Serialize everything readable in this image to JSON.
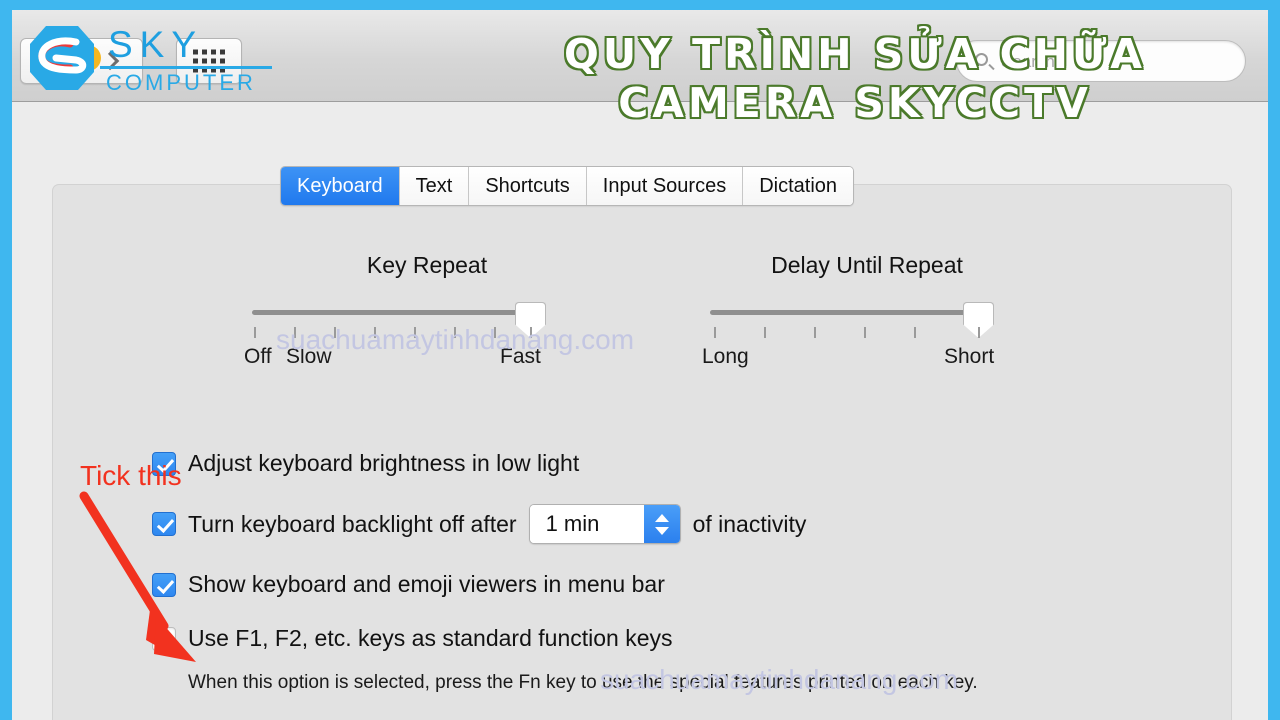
{
  "theme": {
    "frame_color": "#3fb7ef",
    "accent_blue": "#2f87f0",
    "annotation_red": "#f2321f",
    "title_outline_green": "#4b7a2b",
    "logo_blue": "#29a9e6",
    "watermark_color": "#c3c6e2"
  },
  "branding": {
    "logo_primary": "SKY",
    "logo_secondary": "COMPUTER"
  },
  "overlay_title": {
    "line1": "QUY TRÌNH SỬA CHỮA",
    "line2": "CAMERA SKYCCTV"
  },
  "toolbar": {
    "back_label": "Back",
    "forward_label": "Forward",
    "show_all_label": "Show All",
    "search_placeholder": "Search",
    "search_value": ""
  },
  "tabs": [
    {
      "label": "Keyboard",
      "active": true
    },
    {
      "label": "Text",
      "active": false
    },
    {
      "label": "Shortcuts",
      "active": false
    },
    {
      "label": "Input Sources",
      "active": false
    },
    {
      "label": "Dictation",
      "active": false
    }
  ],
  "sliders": {
    "key_repeat": {
      "title": "Key Repeat",
      "label_left": "Off",
      "label_left2": "Slow",
      "label_right": "Fast",
      "ticks": 8,
      "value_percent": 100
    },
    "delay_until_repeat": {
      "title": "Delay Until Repeat",
      "label_left": "Long",
      "label_right": "Short",
      "ticks": 6,
      "value_percent": 100
    }
  },
  "options": [
    {
      "label": "Adjust keyboard brightness in low light",
      "checked": true
    },
    {
      "label_before": "Turn keyboard backlight off after",
      "label_after": "of inactivity",
      "value": "1 min",
      "checked": true
    },
    {
      "label": "Show keyboard and emoji viewers in menu bar",
      "checked": true
    },
    {
      "label": "Use F1, F2, etc. keys as standard function keys",
      "checked": false
    }
  ],
  "help_note": "When this option is selected, press the Fn key to use the special features printed on each key.",
  "annotation": {
    "text": "Tick this"
  },
  "watermarks": {
    "top": "suachuamaytinhdanang.com",
    "bottom": "suachuamaytinhdanang.com"
  }
}
